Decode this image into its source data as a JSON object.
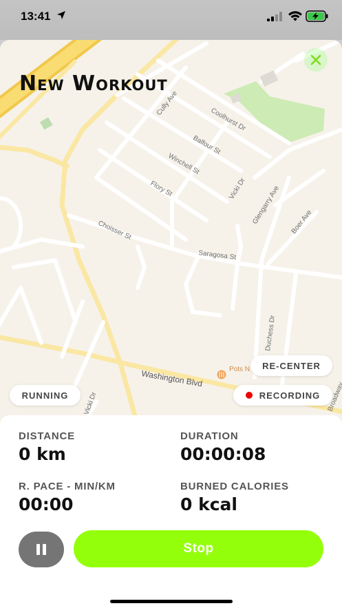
{
  "status_bar": {
    "time": "13:41"
  },
  "header": {
    "title": "New Workout"
  },
  "map": {
    "streets": [
      "Cully Ave",
      "Coolhurst Dr",
      "Balfour St",
      "Winchell St",
      "Flory St",
      "Vicki Dr",
      "Glengarry Ave",
      "Boer Ave",
      "Choisser St",
      "Saragosa St",
      "Duchess Dr",
      "Washington Blvd",
      "Vicki Dr",
      "Broadway",
      "Pots N"
    ],
    "colors": {
      "land": "#f6f2ea",
      "road": "#ffffff",
      "highway": "#f7d35a",
      "park": "#cdebb4"
    }
  },
  "controls": {
    "recenter_label": "RE-CENTER",
    "activity_label": "RUNNING",
    "recording_label": "RECORDING"
  },
  "stats": {
    "distance_label": "DISTANCE",
    "distance_value": "0 km",
    "duration_label": "DURATION",
    "duration_value": "00:00:08",
    "pace_label": "R. PACE - MIN/KM",
    "pace_value": "00:00",
    "calories_label": "BURNED CALORIES",
    "calories_value": "0 kcal"
  },
  "actions": {
    "stop_label": "Stop"
  },
  "colors": {
    "accent": "#94ff0b",
    "recording": "#e00000",
    "pause_button": "#757575"
  }
}
